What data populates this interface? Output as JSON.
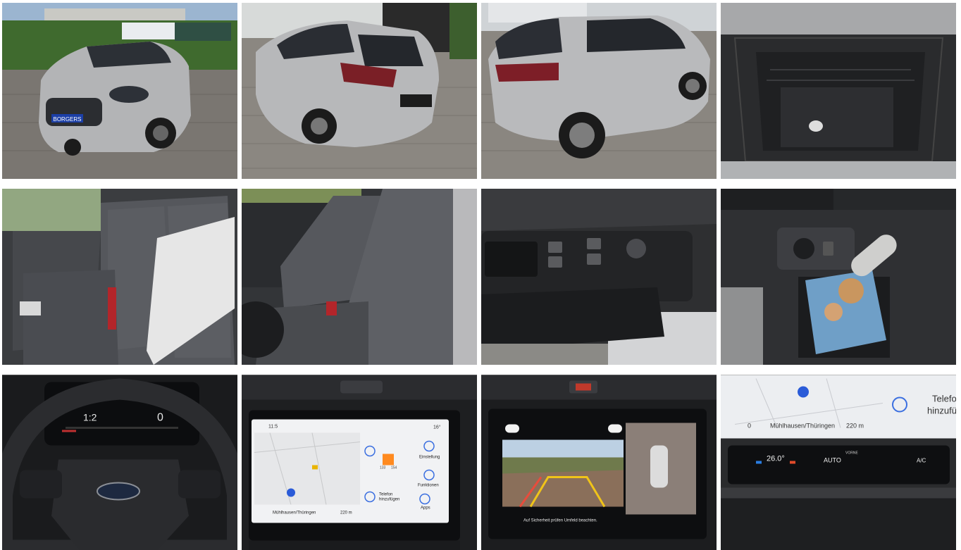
{
  "gallery": {
    "photos": [
      {
        "name": "photo-front-three-quarter"
      },
      {
        "name": "photo-rear-three-quarter-left"
      },
      {
        "name": "photo-rear-three-quarter-right"
      },
      {
        "name": "photo-trunk-storage-bin"
      },
      {
        "name": "photo-rear-seats"
      },
      {
        "name": "photo-front-seats"
      },
      {
        "name": "photo-window-controls"
      },
      {
        "name": "photo-light-switch-console"
      },
      {
        "name": "photo-steering-wheel-cluster"
      },
      {
        "name": "photo-infotainment-screen"
      },
      {
        "name": "photo-rear-camera-display"
      },
      {
        "name": "photo-climate-controls"
      }
    ]
  },
  "plate": {
    "text": "BORGERS"
  },
  "infotainment": {
    "time": "11:5",
    "temp": "16°",
    "phone_line1": "Telefon",
    "phone_line2": "hinzufügen",
    "settings": "Einstellung",
    "functions": "Funktionen",
    "apps": "Apps",
    "nav_city": "Mühlhausen/Thüringen",
    "nav_dist": "220 m",
    "price1": "133",
    "price2": "154"
  },
  "camera": {
    "warning": "Auf Sicherheit prüfen Umfeld beachten."
  },
  "cluster": {
    "gear": "1:2",
    "speed": "0"
  },
  "climate": {
    "phone_line1": "Telefo",
    "phone_line2": "hinzufüg",
    "nav_value": "0",
    "nav_city": "Mühlhausen/Thüringen",
    "nav_dist": "220 m",
    "temp": "26.0°",
    "auto": "AUTO",
    "front": "VORNE",
    "ac": "A/C"
  }
}
